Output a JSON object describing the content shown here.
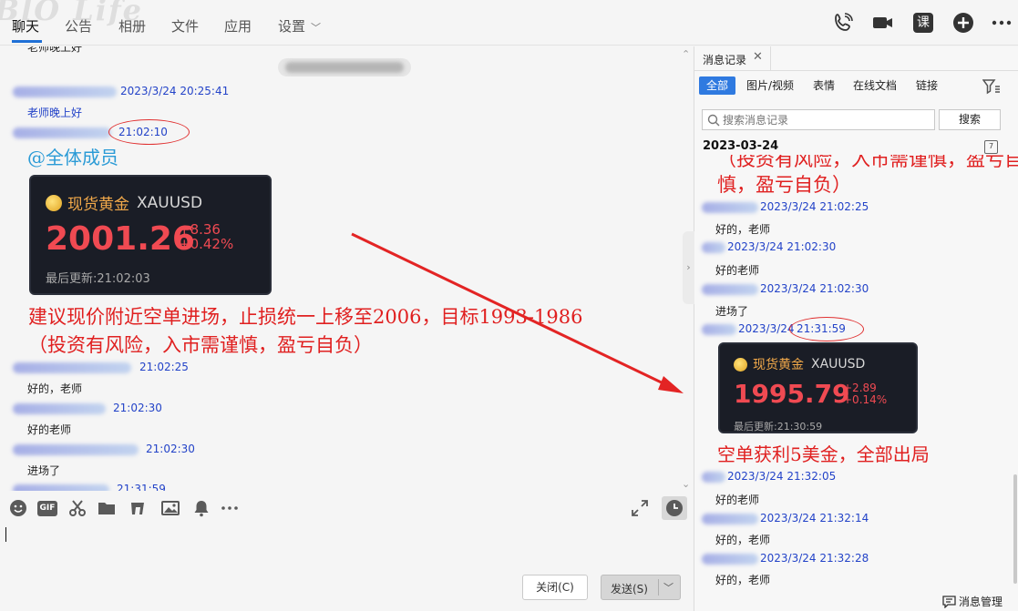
{
  "topbar": {
    "watermark": "BlO Life",
    "tabs": [
      {
        "label": "聊天"
      },
      {
        "label": "公告"
      },
      {
        "label": "相册"
      },
      {
        "label": "文件"
      },
      {
        "label": "应用"
      },
      {
        "label": "设置"
      }
    ],
    "class_label": "课"
  },
  "chat": {
    "partial_top": "老师晚上好",
    "messages": [
      {
        "time": "2023/3/24 20:25:41",
        "text": "老师晚上好"
      },
      {
        "time": "21:02:10"
      },
      {
        "time": "21:02:25",
        "text": "好的，老师"
      },
      {
        "time": "21:02:30",
        "text": "好的老师"
      },
      {
        "time": "21:02:30",
        "text": "进场了"
      },
      {
        "time": "21:31:59"
      }
    ],
    "mention": "@全体成员",
    "card": {
      "name": "现货黄金",
      "symbol": "XAUUSD",
      "price": "2001.26",
      "change": "+8.36",
      "change_pct": "+0.42%",
      "updated": "最后更新:21:02:03"
    },
    "advice_line1": "建议现价附近空单进场，止损统一上移至2006，目标1993-1986",
    "advice_line2": "（投资有风险，入市需谨慎，盈亏自负）"
  },
  "composer": {
    "gif_label": "GIF",
    "close_label": "关闭(C)",
    "send_label": "发送(S)"
  },
  "panel": {
    "tab_label": "消息记录",
    "filters": [
      {
        "label": "全部"
      },
      {
        "label": "图片/视频"
      },
      {
        "label": "表情"
      },
      {
        "label": "在线文档"
      },
      {
        "label": "链接"
      }
    ],
    "search_placeholder": "搜索消息记录",
    "search_button": "搜索",
    "date": "2023-03-24",
    "calendar_label": "7",
    "top_partial": "（投资有风险，入市需谨慎，盈亏自负）",
    "top_line": "慎，盈亏自负）",
    "messages": [
      {
        "time": "2023/3/24 21:02:25",
        "text": "好的，老师"
      },
      {
        "time": "2023/3/24 21:02:30",
        "text": "好的老师"
      },
      {
        "time": "2023/3/24 21:02:30",
        "text": "进场了"
      },
      {
        "time_a": "2023/3/24",
        "time_b": "21:31:59"
      },
      {
        "time": "2023/3/24 21:32:05",
        "text": "好的老师"
      },
      {
        "time": "2023/3/24 21:32:14",
        "text": "好的，老师"
      },
      {
        "time": "2023/3/24 21:32:28",
        "text": "好的，老师"
      }
    ],
    "card": {
      "name": "现货黄金",
      "symbol": "XAUUSD",
      "price": "1995.79",
      "change": "+2.89",
      "change_pct": "+0.14%",
      "updated": "最后更新:21:30:59"
    },
    "profit": "空单获利5美金，全部出局",
    "footer": "消息管理"
  },
  "colors": {
    "accent": "#2f7ae0",
    "annotation_red": "#e02020",
    "timestamp_blue": "#2343c8"
  }
}
